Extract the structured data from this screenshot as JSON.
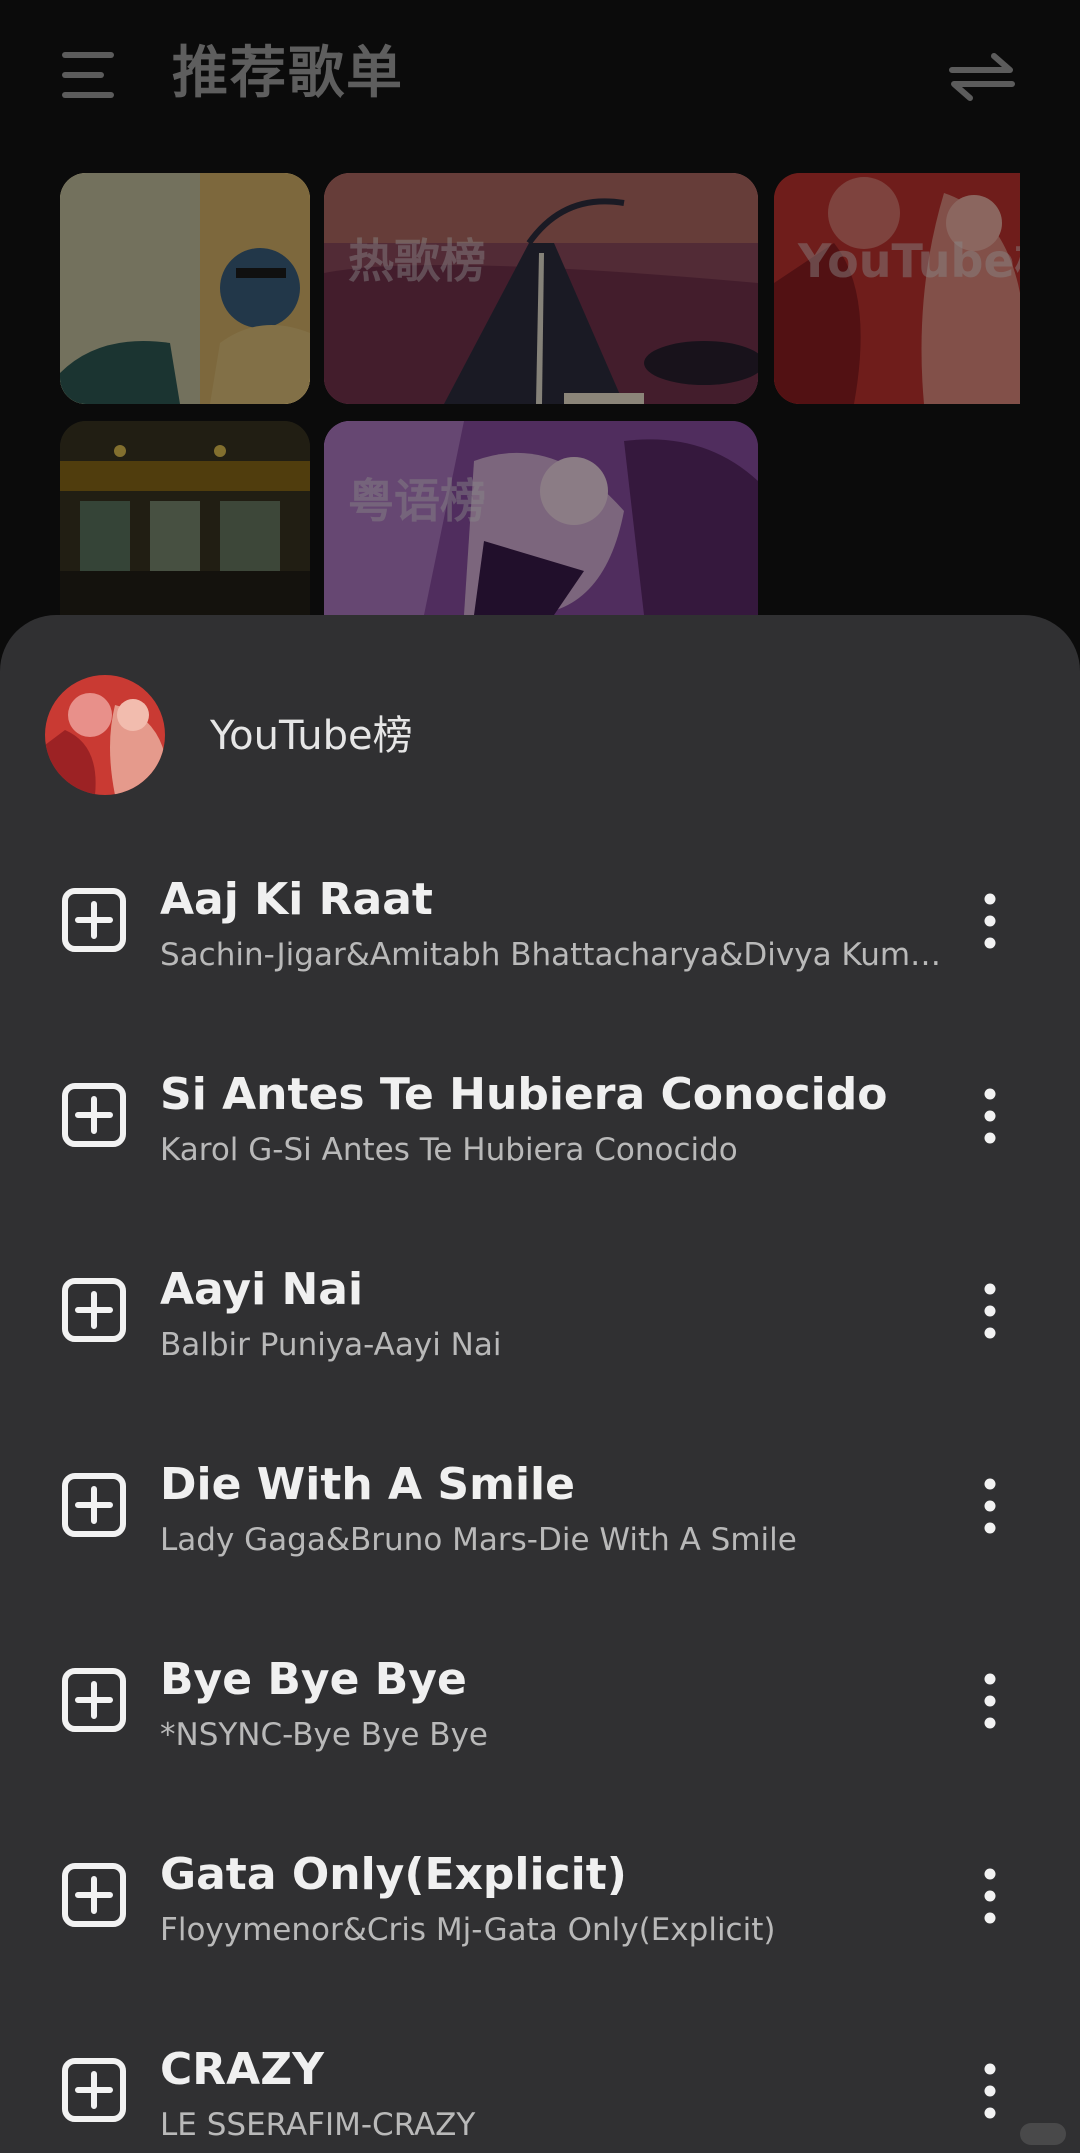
{
  "header": {
    "title": "推荐歌单"
  },
  "playlists": [
    {
      "label": ""
    },
    {
      "label": "热歌榜"
    },
    {
      "label": "YouTube榜"
    },
    {
      "label": ""
    },
    {
      "label": "粤语榜"
    }
  ],
  "sheet": {
    "title": "YouTube榜",
    "songs": [
      {
        "title": "Aaj Ki Raat",
        "artist": "Sachin-Jigar&Amitabh Bhattacharya&Divya Kum…"
      },
      {
        "title": "Si Antes Te Hubiera Conocido",
        "artist": "Karol G-Si Antes Te Hubiera Conocido"
      },
      {
        "title": "Aayi Nai",
        "artist": "Balbir Puniya-Aayi Nai"
      },
      {
        "title": "Die With A Smile",
        "artist": "Lady Gaga&Bruno Mars-Die With A Smile"
      },
      {
        "title": "Bye Bye Bye",
        "artist": "*NSYNC-Bye Bye Bye"
      },
      {
        "title": "Gata Only(Explicit)",
        "artist": "Floyymenor&Cris Mj-Gata Only(Explicit)"
      },
      {
        "title": "CRAZY",
        "artist": "LE SSERAFIM-CRAZY"
      }
    ]
  },
  "colors": {
    "background": "#0b0b0b",
    "sheet": "#303032",
    "title_text": "#f0f0f0",
    "sub_text": "#b9b9b9"
  }
}
